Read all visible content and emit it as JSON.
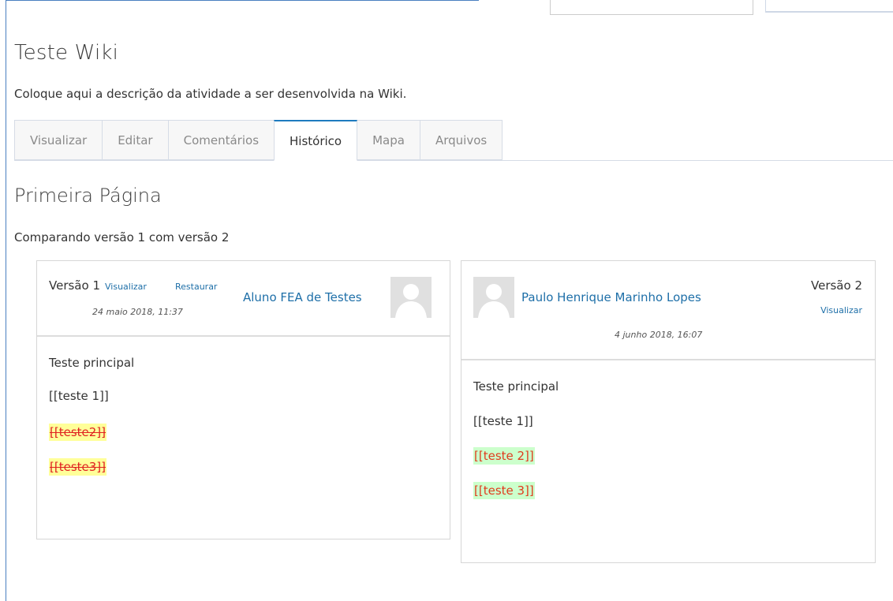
{
  "wiki": {
    "title": "Teste Wiki",
    "description": "Coloque aqui a descrição da atividade a ser desenvolvida na Wiki."
  },
  "tabs": [
    {
      "label": "Visualizar",
      "active": false
    },
    {
      "label": "Editar",
      "active": false
    },
    {
      "label": "Comentários",
      "active": false
    },
    {
      "label": "Histórico",
      "active": true
    },
    {
      "label": "Mapa",
      "active": false
    },
    {
      "label": "Arquivos",
      "active": false
    }
  ],
  "page": {
    "title": "Primeira Página",
    "compare_text": "Comparando versão 1 com versão 2"
  },
  "left_version": {
    "label": "Versão 1",
    "view_link": "Visualizar",
    "restore_link": "Restaurar",
    "date": "24 maio 2018, 11:37",
    "author": "Aluno FEA de Testes",
    "lines": [
      {
        "text": "Teste principal",
        "type": "normal"
      },
      {
        "text": "[[teste 1]]",
        "type": "normal"
      },
      {
        "text": "[[teste2]]",
        "type": "deleted"
      },
      {
        "text": "[[teste3]]",
        "type": "deleted"
      }
    ]
  },
  "right_version": {
    "label": "Versão 2",
    "view_link": "Visualizar",
    "date": "4 junho 2018, 16:07",
    "author": "Paulo Henrique Marinho Lopes",
    "lines": [
      {
        "text": "Teste principal",
        "type": "normal"
      },
      {
        "text": "[[teste 1]]",
        "type": "normal"
      },
      {
        "text": "[[teste 2]]",
        "type": "added"
      },
      {
        "text": "[[teste 3]]",
        "type": "added"
      }
    ]
  },
  "colors": {
    "accent": "#1e7bbf",
    "link": "#1e6fa8",
    "deleted_bg": "#ffff99",
    "added_bg": "#ccffcc",
    "diff_text": "#e02020"
  }
}
